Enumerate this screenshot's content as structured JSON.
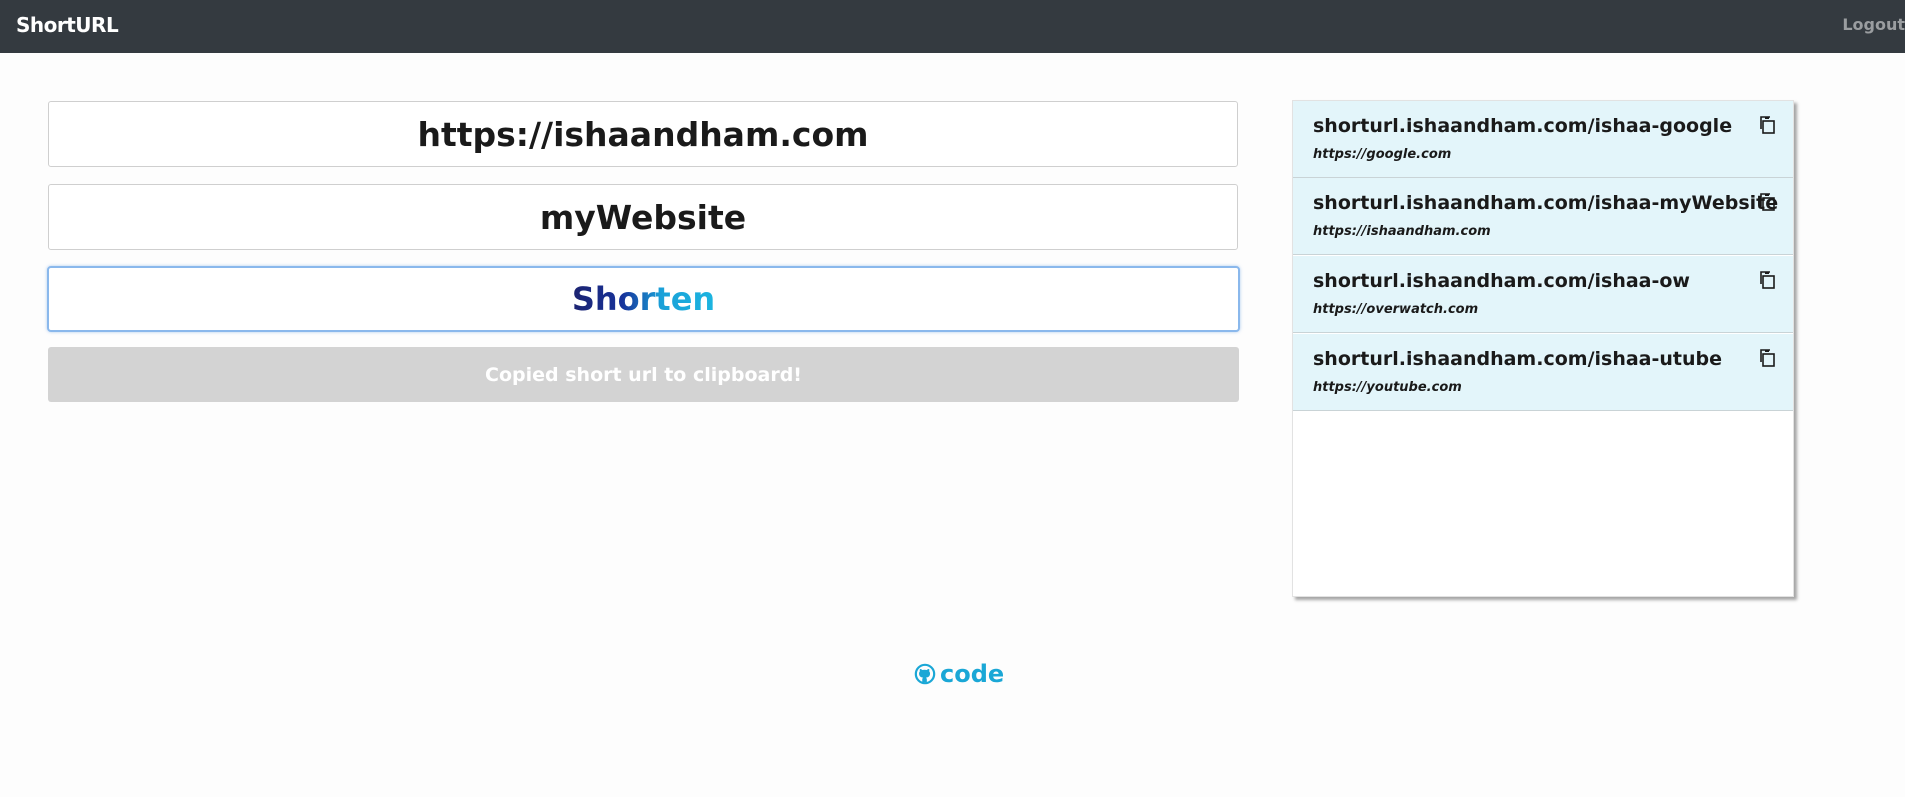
{
  "navbar": {
    "brand": "ShortURL",
    "logout": "Logout"
  },
  "form": {
    "url_value": "https://ishaandham.com",
    "name_value": "myWebsite",
    "shorten_label": "Shorten",
    "status_message": "Copied short url to clipboard!"
  },
  "links": [
    {
      "short": "shorturl.ishaandham.com/ishaa-google",
      "long": "https://google.com"
    },
    {
      "short": "shorturl.ishaandham.com/ishaa-myWebsite",
      "long": "https://ishaandham.com"
    },
    {
      "short": "shorturl.ishaandham.com/ishaa-ow",
      "long": "https://overwatch.com"
    },
    {
      "short": "shorturl.ishaandham.com/ishaa-utube",
      "long": "https://youtube.com"
    }
  ],
  "footer": {
    "code_label": "code",
    "icon": "github-icon"
  },
  "icons": {
    "copy": "copy-icon"
  },
  "colors": {
    "navbar": "#343a40",
    "list_item_bg": "#e3f5fa",
    "accent": "#1aa7d6",
    "status_bar": "#d3d3d3"
  }
}
